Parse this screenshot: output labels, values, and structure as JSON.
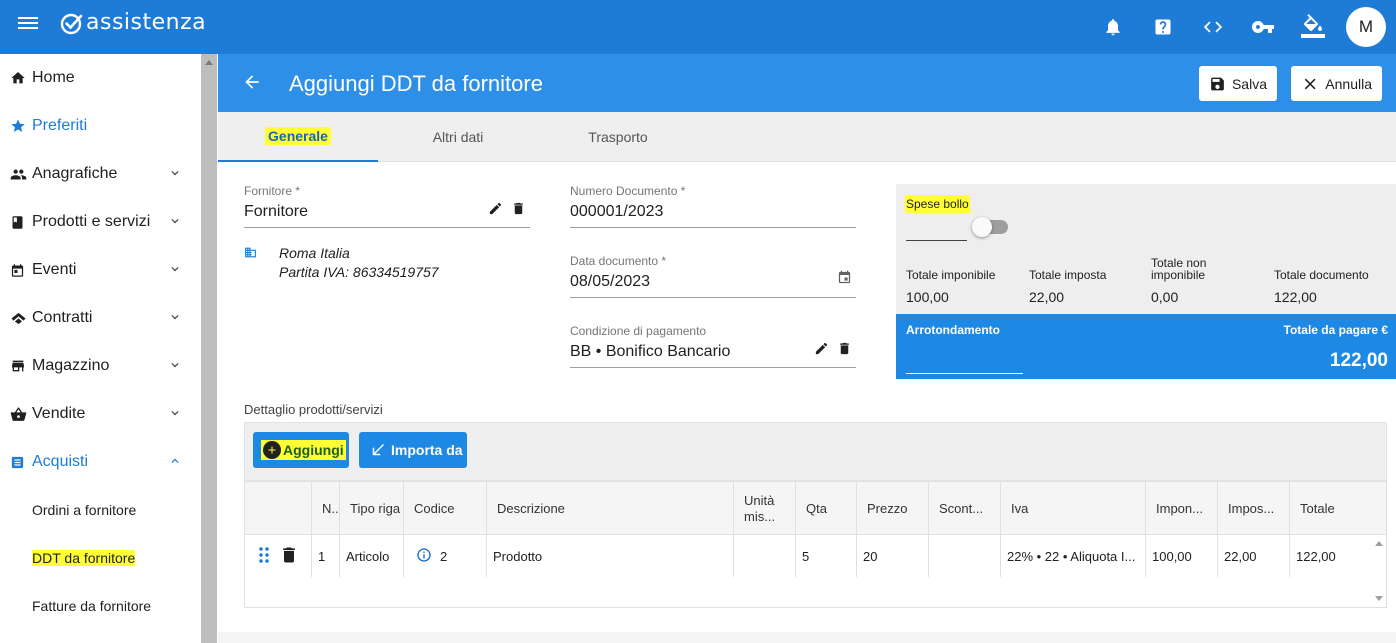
{
  "app": {
    "brand": "assistenza",
    "avatar_initial": "M"
  },
  "topbar": {
    "icons": [
      "notifications-icon",
      "help-icon",
      "code-icon",
      "key-icon",
      "paint-bucket-icon"
    ]
  },
  "sidebar": {
    "items": [
      {
        "label": "Home",
        "icon": "home-icon",
        "expandable": false
      },
      {
        "label": "Preferiti",
        "icon": "star-icon",
        "expandable": false
      },
      {
        "label": "Anagrafiche",
        "icon": "people-icon",
        "expandable": true
      },
      {
        "label": "Prodotti e servizi",
        "icon": "book-icon",
        "expandable": true
      },
      {
        "label": "Eventi",
        "icon": "calendar-icon",
        "expandable": true
      },
      {
        "label": "Contratti",
        "icon": "handshake-icon",
        "expandable": true
      },
      {
        "label": "Magazzino",
        "icon": "store-icon",
        "expandable": true
      },
      {
        "label": "Vendite",
        "icon": "basket-icon",
        "expandable": true
      },
      {
        "label": "Acquisti",
        "icon": "list-icon",
        "expandable": true,
        "expanded": true
      }
    ],
    "subitems": [
      {
        "label": "Ordini a fornitore"
      },
      {
        "label": "DDT da fornitore",
        "highlighted": true
      },
      {
        "label": "Fatture da fornitore"
      }
    ]
  },
  "header": {
    "title": "Aggiungi DDT da fornitore",
    "save_label": "Salva",
    "cancel_label": "Annulla"
  },
  "tabs": [
    {
      "label": "Generale",
      "active": true
    },
    {
      "label": "Altri dati",
      "active": false
    },
    {
      "label": "Trasporto",
      "active": false
    }
  ],
  "form": {
    "fornitore": {
      "label": "Fornitore *",
      "value": "Fornitore"
    },
    "supplier_info": {
      "city": "Roma Italia",
      "vat": "Partita IVA: 86334519757"
    },
    "numero_documento": {
      "label": "Numero Documento *",
      "value": "000001/2023"
    },
    "data_documento": {
      "label": "Data documento *",
      "value": "08/05/2023"
    },
    "condizione_pagamento": {
      "label": "Condizione di pagamento",
      "value": "BB • Bonifico Bancario"
    }
  },
  "totals": {
    "spese_bollo_label": "Spese bollo",
    "spese_bollo_enabled": false,
    "columns": [
      {
        "label": "Totale imponibile",
        "value": "100,00"
      },
      {
        "label": "Totale imposta",
        "value": "22,00"
      },
      {
        "label": "Totale non imponibile",
        "value": "0,00"
      },
      {
        "label": "Totale documento",
        "value": "122,00"
      }
    ],
    "arrotondamento_label": "Arrotondamento",
    "totale_da_pagare_label": "Totale da pagare €",
    "totale_da_pagare_value": "122,00"
  },
  "details": {
    "label": "Dettaglio prodotti/servizi",
    "add_label": "Aggiungi",
    "import_label": "Importa da",
    "columns": [
      "N...",
      "Tipo riga",
      "Codice",
      "Descrizione",
      "Unità mis...",
      "Qta",
      "Prezzo",
      "Scont...",
      "Iva",
      "Impon...",
      "Impos...",
      "Totale"
    ],
    "rows": [
      {
        "n": "1",
        "tipo": "Articolo",
        "codice": "2",
        "descrizione": "Prodotto",
        "unita": "",
        "qta": "5",
        "prezzo": "20",
        "sconto": "",
        "iva": "22% • 22 • Aliquota I...",
        "imponibile": "100,00",
        "imposta": "22,00",
        "totale": "122,00"
      }
    ]
  },
  "colors": {
    "primary": "#1e7bd6",
    "header": "#2d8fe8",
    "highlight": "#ffff33"
  }
}
